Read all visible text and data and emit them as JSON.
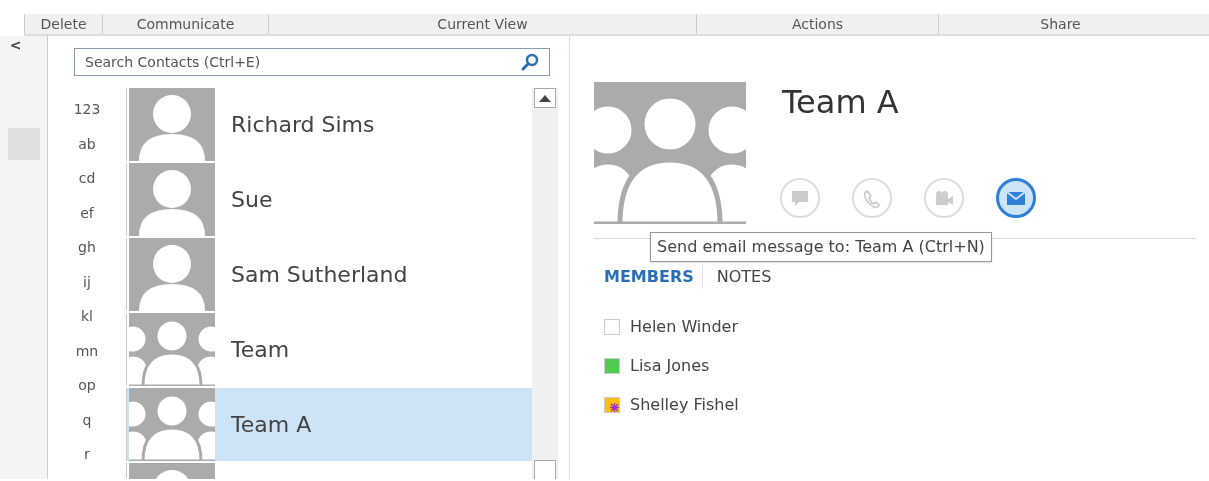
{
  "ribbon_groups": [
    "Delete",
    "Communicate",
    "Current View",
    "Actions",
    "Share"
  ],
  "collapse_button": "<",
  "search": {
    "placeholder": "Search Contacts (Ctrl+E)"
  },
  "index_letters": [
    "123",
    "ab",
    "cd",
    "ef",
    "gh",
    "ij",
    "kl",
    "mn",
    "op",
    "q",
    "r"
  ],
  "contacts": [
    {
      "name": "Richard Sims",
      "kind": "person",
      "selected": false
    },
    {
      "name": "Sue",
      "kind": "person",
      "selected": false
    },
    {
      "name": "Sam Sutherland",
      "kind": "person",
      "selected": false
    },
    {
      "name": "Team",
      "kind": "group",
      "selected": false
    },
    {
      "name": "Team A",
      "kind": "group",
      "selected": true
    },
    {
      "kind": "person",
      "selected": false
    }
  ],
  "detail": {
    "title": "Team A",
    "actions": [
      {
        "kind": "chat",
        "active": false
      },
      {
        "kind": "phone",
        "active": false
      },
      {
        "kind": "video",
        "active": false
      },
      {
        "kind": "email",
        "active": true
      }
    ],
    "tooltip": "Send email message to: Team A (Ctrl+N)",
    "tabs": [
      {
        "label": "MEMBERS",
        "selected": true
      },
      {
        "label": "NOTES",
        "selected": false
      }
    ],
    "members": [
      {
        "name": "Helen Winder",
        "color": "#ffffff",
        "flagged": false
      },
      {
        "name": "Lisa Jones",
        "color": "#4fcc4f",
        "flagged": false
      },
      {
        "name": "Shelley Fishel",
        "color": "#ffc000",
        "flagged": true
      }
    ]
  }
}
